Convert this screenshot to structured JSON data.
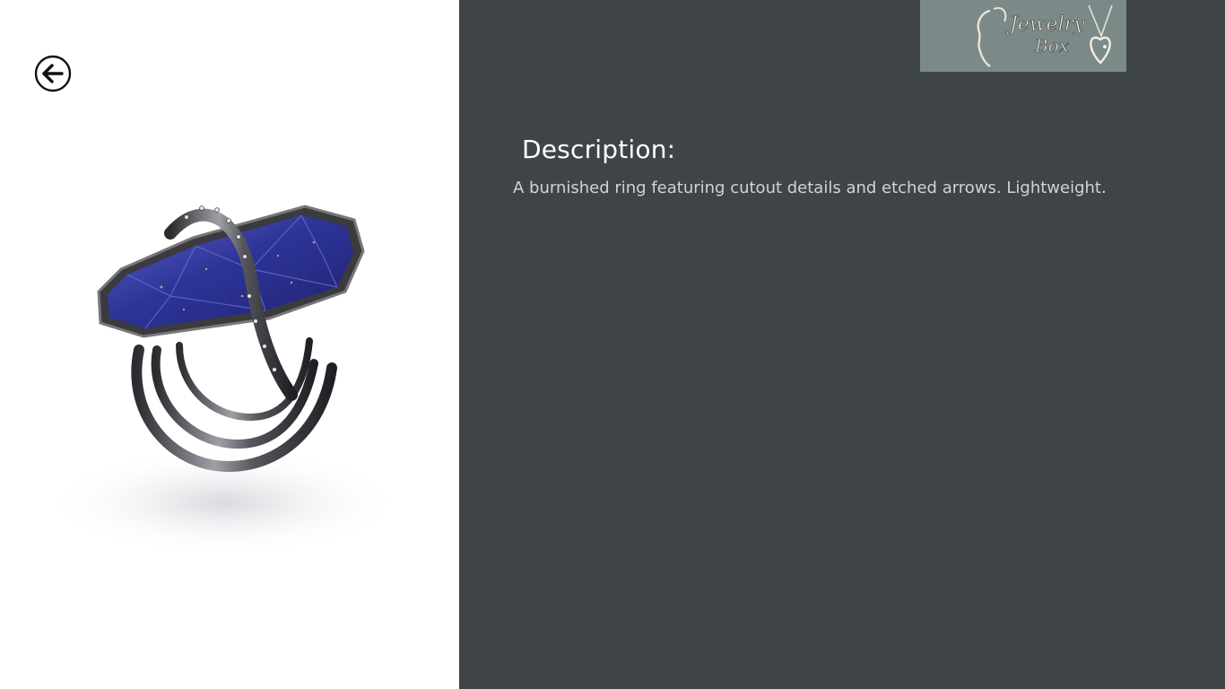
{
  "header": {
    "back_icon": "back-arrow-circle-icon",
    "logo_text_line1": "Jewelry",
    "logo_text_line2": "Box",
    "logo_bg": "#7b8a89"
  },
  "product": {
    "image_alt": "Silver ring with blue lapis stone",
    "description_heading": "Description:",
    "description_text": "A burnished ring featuring cutout details and etched arrows. Lightweight."
  },
  "colors": {
    "left_background": "#ffffff",
    "right_background": "#3e4447",
    "heading": "#ffffff",
    "body_text": "#cfd4d6",
    "stone": "#3a3fa3"
  }
}
